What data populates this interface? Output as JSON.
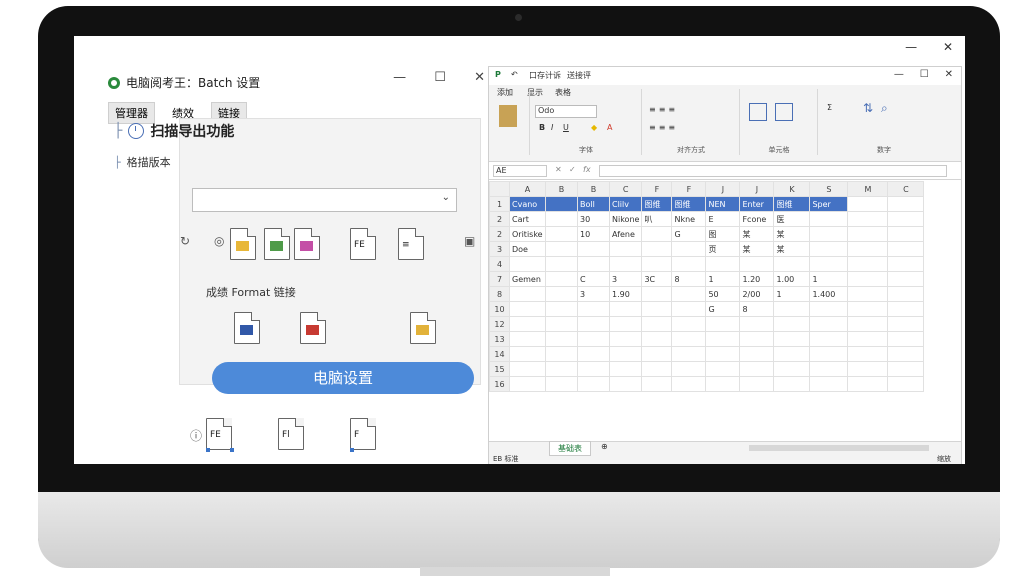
{
  "left_app": {
    "title": "电脑阅考王：Batch 设置",
    "window_controls": [
      "—",
      "☐",
      "✕"
    ],
    "tabs": [
      "管理器",
      "绩效",
      "链接"
    ],
    "section_title": "扫描导出功能",
    "field_label": "格描版本",
    "dropdown_value": "",
    "format_label": "成绩 Format 链接",
    "action_button": "电脑设置",
    "icon_file_labels": [
      "FE",
      "Fl",
      "F"
    ]
  },
  "screen_controls": [
    "—",
    "✕"
  ],
  "excel": {
    "title_items": [
      "口存计诉",
      "送接评"
    ],
    "window_controls": [
      "—",
      "☐",
      "✕"
    ],
    "menu_items": [
      "添加",
      "显示",
      "表格"
    ],
    "font_name": "Odo",
    "ribbon_groups": [
      "字体",
      "对齐方式",
      "单元格",
      "数字"
    ],
    "name_box": "AE",
    "column_headers": [
      "A",
      "B",
      "B",
      "C",
      "F",
      "F",
      "J",
      "J",
      "K",
      "S",
      "M",
      "C"
    ],
    "row_headers": [
      "1",
      "2",
      "2",
      "3",
      "4",
      "7",
      "8",
      "10",
      "12",
      "13",
      "14",
      "15",
      "16"
    ],
    "header_row": [
      "Cvano",
      "",
      "Boll",
      "Clilv",
      "图维",
      "图维",
      "NEN",
      "Enter",
      "图维",
      "Sper"
    ],
    "rows": [
      [
        "Cart",
        "",
        "30",
        "Nikone",
        "叭",
        "Nkne",
        "E",
        "Fcone",
        "医"
      ],
      [
        "Oritiske",
        "",
        "10",
        "Afene",
        "",
        "G",
        "图",
        "某",
        "某"
      ],
      [
        "Doe",
        "",
        "",
        "",
        "",
        "",
        "页",
        "某",
        "某"
      ],
      [
        "",
        "",
        "",
        "",
        "",
        "",
        "",
        "",
        ""
      ],
      [
        "Gemen",
        "",
        "C",
        "3",
        "3C",
        "8",
        "1",
        "1.20",
        "1.00",
        "1"
      ],
      [
        "",
        "",
        "3",
        "1.90",
        "",
        "",
        "50",
        "2/00",
        "1",
        "1.400"
      ],
      [
        "",
        "",
        "",
        "",
        "",
        "",
        "G",
        "8",
        "",
        ""
      ]
    ],
    "sheet_tab": "基础表",
    "status_left": "EB 标准",
    "status_right": "缩放"
  },
  "colors": {
    "accent_blue": "#4472c4",
    "button_blue": "#4d8ad9",
    "logo_green": "#2a8a3c"
  }
}
